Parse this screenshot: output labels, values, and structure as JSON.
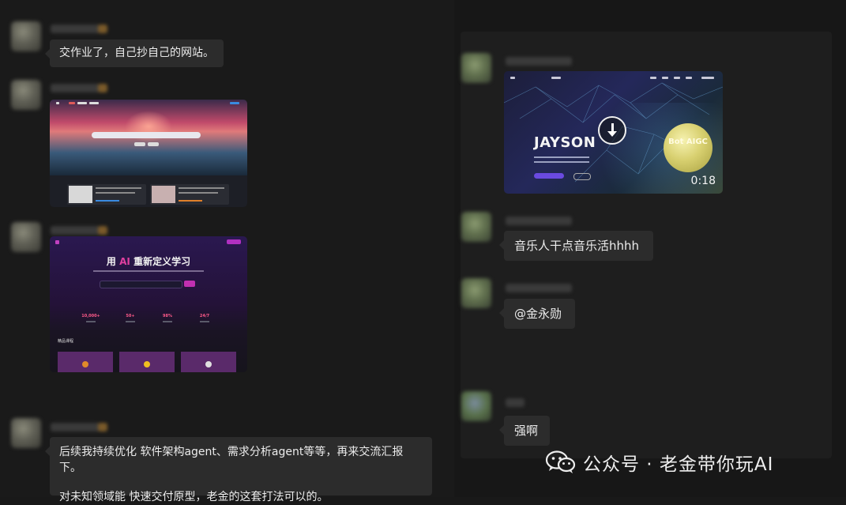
{
  "left_chat": {
    "messages": [
      {
        "type": "text",
        "text": "交作业了，自己抄自己的网站。"
      },
      {
        "type": "image"
      },
      {
        "type": "image",
        "page_title": "用 AI 重新定义学习",
        "title_prefix": "用",
        "title_ai": "AI",
        "title_suffix": "重新定义学习",
        "stats": [
          "10,000+",
          "50+",
          "98%",
          "24/7"
        ],
        "section_title": "精品课程"
      },
      {
        "type": "text",
        "lines": [
          "后续我持续优化 软件架构agent、需求分析agent等等，再来交流汇报下。",
          "对未知领域能 快速交付原型，老金的这套打法可以的。"
        ]
      }
    ]
  },
  "right_chat": {
    "messages": [
      {
        "type": "video",
        "brand": "JAYSON",
        "badge": "Bot AIGC",
        "duration": "0:18"
      },
      {
        "type": "text",
        "text": "音乐人干点音乐活hhhh"
      },
      {
        "type": "text",
        "text": "@金永勋"
      },
      {
        "type": "text",
        "text": "强啊"
      }
    ]
  },
  "watermark": {
    "text": "公众号 · 老金带你玩AI",
    "icon": "wechat-icon"
  },
  "colors": {
    "background": "#191919",
    "bubble": "#2c2c2c",
    "text": "#ececec"
  }
}
